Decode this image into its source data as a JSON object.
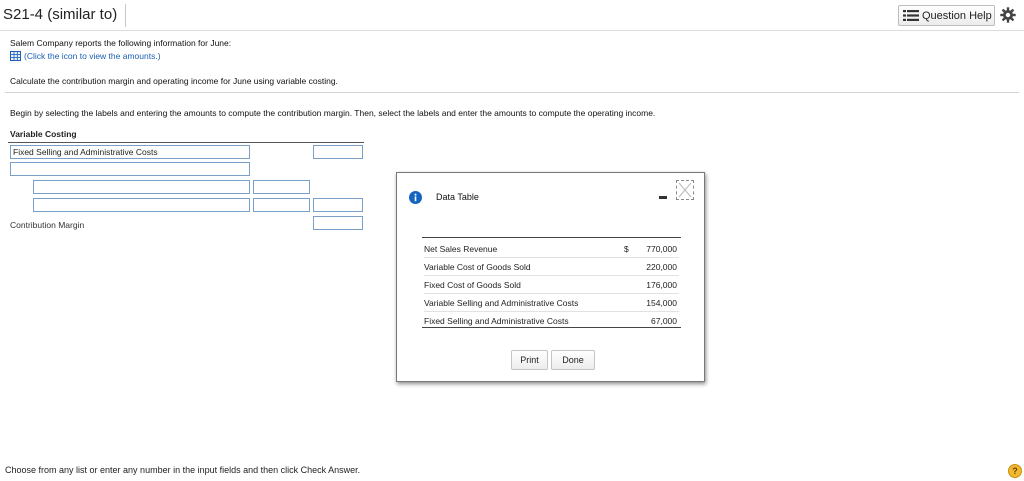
{
  "header": {
    "title": "S21-4 (similar to)",
    "help_label": "Question Help"
  },
  "question": {
    "intro": "Salem Company reports the following information for June:",
    "link_text": "(Click the icon to view the amounts.)",
    "task": "Calculate the contribution margin and operating income for June using variable costing.",
    "instruction": "Begin by selecting the labels and entering the amounts to compute the contribution margin. Then, select the labels and enter the amounts to compute the operating income."
  },
  "worksheet": {
    "heading": "Variable Costing",
    "row1_label_value": "Fixed Selling and Administrative Costs",
    "row1_amount": "",
    "row2_label_value": "",
    "row3_label_value": "",
    "row3_amount_a": "",
    "row4_label_value": "",
    "row4_amount_a": "",
    "row4_amount_b": "",
    "contribution_margin_label": "Contribution Margin",
    "contribution_margin_amount": ""
  },
  "dialog": {
    "title": "Data Table",
    "rows": [
      {
        "label": "Net Sales Revenue",
        "dollar": "$",
        "value": "770,000"
      },
      {
        "label": "Variable Cost of Goods Sold",
        "dollar": "",
        "value": "220,000"
      },
      {
        "label": "Fixed Cost of Goods Sold",
        "dollar": "",
        "value": "176,000"
      },
      {
        "label": "Variable Selling and Administrative Costs",
        "dollar": "",
        "value": "154,000"
      },
      {
        "label": "Fixed Selling and Administrative Costs",
        "dollar": "",
        "value": "67,000"
      }
    ],
    "print_label": "Print",
    "done_label": "Done"
  },
  "footer": {
    "text": "Choose from any list or enter any number in the input fields and then click Check Answer.",
    "help_glyph": "?"
  },
  "colors": {
    "link": "#1a5fb4",
    "input_border": "#7aa0c8",
    "info_icon": "#1565c0",
    "help_icon": "#f2b830"
  }
}
